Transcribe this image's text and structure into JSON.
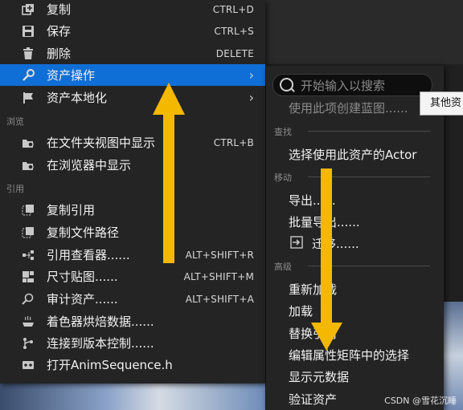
{
  "main_menu": {
    "items": [
      {
        "label": "复制",
        "shortcut": "CTRL+D",
        "icon": "copy-icon"
      },
      {
        "label": "保存",
        "shortcut": "CTRL+S",
        "icon": "save-icon"
      },
      {
        "label": "删除",
        "shortcut": "DELETE",
        "icon": "trash-icon"
      },
      {
        "label": "资产操作",
        "icon": "wrench-icon",
        "has_submenu": true
      },
      {
        "label": "资产本地化",
        "icon": "flag-icon",
        "has_submenu": true
      }
    ],
    "section_browse": "浏览",
    "browse_items": [
      {
        "label": "在文件夹视图中显示",
        "shortcut": "CTRL+B",
        "icon": "folder-search-icon"
      },
      {
        "label": "在浏览器中显示",
        "icon": "folder-search-icon"
      }
    ],
    "section_reference": "引用",
    "reference_items": [
      {
        "label": "复制引用",
        "icon": "copy-reference-icon"
      },
      {
        "label": "复制文件路径",
        "icon": "copy-path-icon"
      },
      {
        "label": "引用查看器......",
        "shortcut": "ALT+SHIFT+R",
        "icon": "reference-viewer-icon"
      },
      {
        "label": "尺寸贴图......",
        "shortcut": "ALT+SHIFT+M",
        "icon": "size-map-icon"
      },
      {
        "label": "审计资产......",
        "shortcut": "ALT+SHIFT+A",
        "icon": "audit-icon"
      },
      {
        "label": "着色器烘焙数据......",
        "icon": "shader-icon"
      },
      {
        "label": "连接到版本控制......",
        "icon": "source-control-icon"
      },
      {
        "label": "打开AnimSequence.h",
        "icon": "cpp-file-icon"
      }
    ]
  },
  "submenu": {
    "search_placeholder": "开始输入以搜索",
    "create_blueprint": "使用此项创建蓝图......",
    "section_find": "查找",
    "select_actor": "选择使用此资产的Actor",
    "section_move": "移动",
    "export": "导出......",
    "bulk_export": "批量导出......",
    "migrate": "迁移......",
    "section_advanced": "高级",
    "reimport": "重新加载",
    "load": "加载",
    "replace_refs": "替换引用",
    "edit_matrix": "编辑属性矩阵中的选择",
    "show_metadata": "显示元数据",
    "validate": "验证资产"
  },
  "tooltip": "其他资",
  "watermark": "CSDN @雪花沉睡",
  "colors": {
    "highlight": "#0f6fd6",
    "arrow": "#f5b800",
    "menu_bg": "#242424"
  }
}
